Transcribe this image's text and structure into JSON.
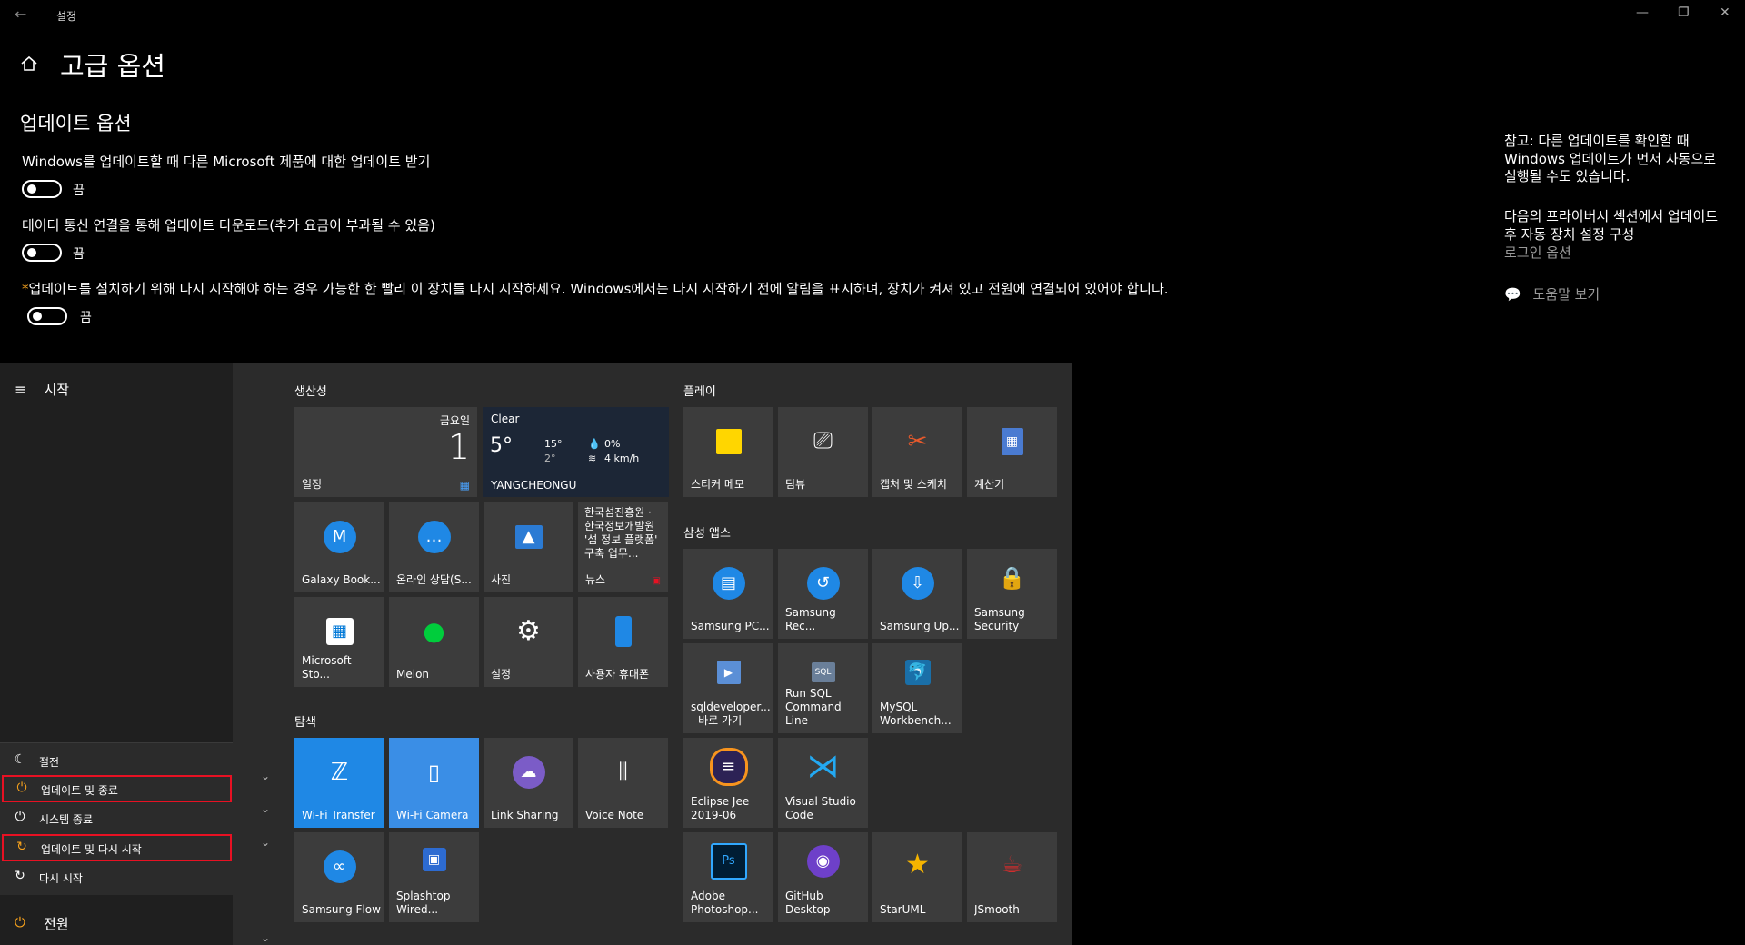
{
  "window": {
    "title": "설정",
    "back_glyph": "←",
    "min_glyph": "—",
    "max_glyph": "❐",
    "close_glyph": "✕"
  },
  "page": {
    "title": "고급 옵션",
    "section": "업데이트 옵션",
    "options": [
      {
        "label": "Windows를 업데이트할 때 다른 Microsoft 제품에 대한 업데이트 받기",
        "state": "끔"
      },
      {
        "label": "데이터 통신 연결을 통해 업데이트 다운로드(추가 요금이 부과될 수 있음)",
        "state": "끔"
      },
      {
        "label": "업데이트를 설치하기 위해 다시 시작해야 하는 경우 가능한 한 빨리 이 장치를 다시 시작하세요. Windows에서는 다시 시작하기 전에 알림을 표시하며, 장치가 켜져 있고 전원에 연결되어 있어야 합니다.",
        "state": "끔",
        "prefix": "*"
      }
    ]
  },
  "side": {
    "note": "참고: 다른 업데이트를 확인할 때 Windows 업데이트가 먼저 자동으로 실행될 수도 있습니다.",
    "privacy": "다음의 프라이버시 섹션에서 업데이트 후 자동 장치 설정 구성",
    "login_link": "로그인 옵션",
    "help": "도움말 보기"
  },
  "start": {
    "header": "시작",
    "power_menu": [
      {
        "label": "절전",
        "icon": "moon-icon",
        "glyph": "☾"
      },
      {
        "label": "업데이트 및 종료",
        "icon": "update-power-icon",
        "glyph": "⏻",
        "highlight": true
      },
      {
        "label": "시스템 종료",
        "icon": "power-icon",
        "glyph": "⏻"
      },
      {
        "label": "업데이트 및 다시 시작",
        "icon": "update-restart-icon",
        "glyph": "↻",
        "highlight": true
      },
      {
        "label": "다시 시작",
        "icon": "restart-icon",
        "glyph": "↻"
      }
    ],
    "power": "전원",
    "chevron": "⌄",
    "groups": {
      "productivity": "생산성",
      "explore": "탐색",
      "play": "플레이",
      "samsung": "삼성 앱스"
    },
    "calendar": {
      "day": "금요일",
      "date": "1",
      "label": "일정"
    },
    "weather": {
      "cond": "Clear",
      "temp": "5°",
      "hi": "15°",
      "lo": "2°",
      "precip": "0%",
      "wind": "4 km/h",
      "city": "YANGCHEONGU"
    },
    "news": {
      "text": "한국섬진흥원 · 한국정보개발원 '섬 정보 플랫폼' 구축 업무...",
      "label": "뉴스"
    },
    "tiles": {
      "galaxy": "Galaxy Book...",
      "consult": "온라인 상담(S...",
      "photo": "사진",
      "store": "Microsoft Sto...",
      "melon": "Melon",
      "settings": "설정",
      "phone": "사용자 휴대폰",
      "wifi_transfer": "Wi-Fi Transfer",
      "wifi_camera": "Wi-Fi Camera",
      "link_sharing": "Link Sharing",
      "voice_note": "Voice Note",
      "samsung_flow": "Samsung Flow",
      "splashtop": "Splashtop Wired...",
      "sticky": "스티커 메모",
      "teams": "팀뷰",
      "snip": "캡처 및 스케치",
      "calc": "계산기",
      "s_pc": "Samsung PC...",
      "s_rec": "Samsung Rec...",
      "s_up": "Samsung Up...",
      "s_sec": "Samsung Security",
      "sqldev": "sqldeveloper.... - 바로 가기",
      "runsql": "Run SQL Command Line",
      "mysql": "MySQL Workbench...",
      "eclipse": "Eclipse Jee 2019-06",
      "vscode": "Visual Studio Code",
      "ps": "Adobe Photoshop...",
      "github": "GitHub Desktop",
      "staruml": "StarUML",
      "jsmooth": "JSmooth"
    }
  }
}
